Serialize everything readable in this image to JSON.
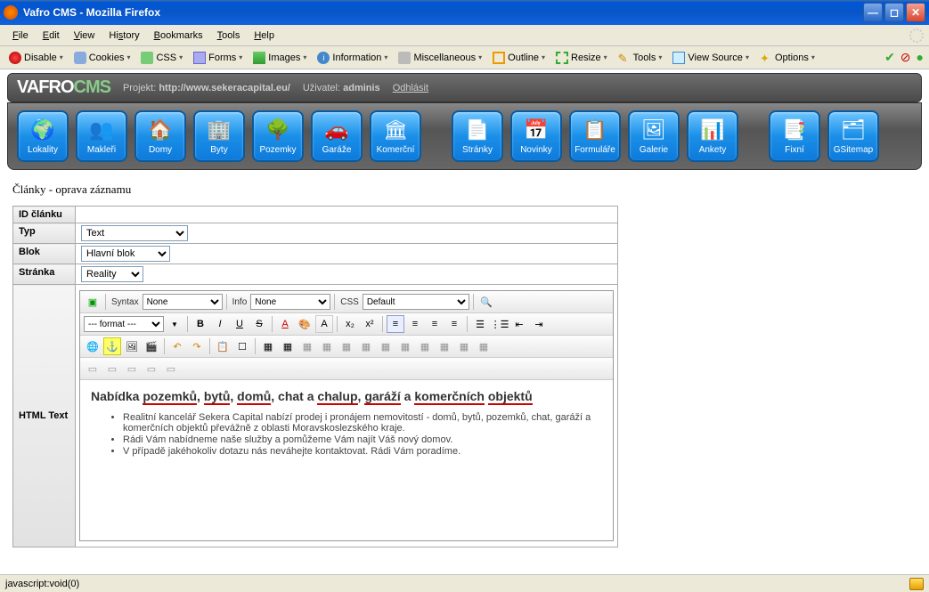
{
  "window": {
    "title": "Vafro CMS - Mozilla Firefox"
  },
  "menu": {
    "file": "File",
    "edit": "Edit",
    "view": "View",
    "history": "History",
    "bookmarks": "Bookmarks",
    "tools": "Tools",
    "help": "Help"
  },
  "devbar": {
    "disable": "Disable",
    "cookies": "Cookies",
    "css": "CSS",
    "forms": "Forms",
    "images": "Images",
    "information": "Information",
    "miscellaneous": "Miscellaneous",
    "outline": "Outline",
    "resize": "Resize",
    "tools": "Tools",
    "view_source": "View Source",
    "options": "Options"
  },
  "cms_header": {
    "logo_a": "VAFRO",
    "logo_b": "CMS",
    "projekt_label": "Projekt:",
    "projekt_value": "http://www.sekeracapital.eu/",
    "user_label": "Uživatel:",
    "user_value": "adminis",
    "logout": "Odhlásit"
  },
  "iconbar": [
    {
      "name": "lokality",
      "label": "Lokality"
    },
    {
      "name": "makleri",
      "label": "Makleři"
    },
    {
      "name": "domy",
      "label": "Domy"
    },
    {
      "name": "byty",
      "label": "Byty"
    },
    {
      "name": "pozemky",
      "label": "Pozemky"
    },
    {
      "name": "garaze",
      "label": "Garáže"
    },
    {
      "name": "komercni",
      "label": "Komerční"
    },
    {
      "name": "stranky",
      "label": "Stránky"
    },
    {
      "name": "novinky",
      "label": "Novinky"
    },
    {
      "name": "formulare",
      "label": "Formuláře"
    },
    {
      "name": "galerie",
      "label": "Galerie"
    },
    {
      "name": "ankety",
      "label": "Ankety"
    },
    {
      "name": "fixni",
      "label": "Fixní"
    },
    {
      "name": "gsitemap",
      "label": "GSitemap"
    }
  ],
  "page": {
    "title": "Články - oprava záznamu",
    "rows": {
      "id_label": "ID článku",
      "typ_label": "Typ",
      "typ_value": "Text",
      "blok_label": "Blok",
      "blok_value": "Hlavní blok",
      "stranka_label": "Stránka",
      "stranka_value": "Reality",
      "html_label": "HTML Text"
    }
  },
  "rte": {
    "syntax_label": "Syntax",
    "syntax_value": "None",
    "info_label": "Info",
    "info_value": "None",
    "css_label": "CSS",
    "css_value": "Default",
    "format_value": "--- format ---"
  },
  "editor_content": {
    "heading_parts": [
      "Nabídka ",
      "pozemků",
      ", ",
      "bytů",
      ", ",
      "domů",
      ", chat a ",
      "chalup",
      ", ",
      "garáží",
      " a ",
      "komerčních",
      " ",
      "objektů"
    ],
    "bullets": [
      "Realitní kancelář Sekera Capital nabízí prodej i pronájem nemovitostí - domů, bytů, pozemků, chat, garáží a komerčních objektů převážně z oblasti Moravskoslezského kraje.",
      "Rádi Vám nabídneme naše služby a pomůžeme Vám najít Váš nový domov.",
      "V případě jakéhokoliv dotazu nás neváhejte kontaktovat. Rádi Vám poradíme."
    ]
  },
  "status": {
    "text": "javascript:void(0)"
  }
}
